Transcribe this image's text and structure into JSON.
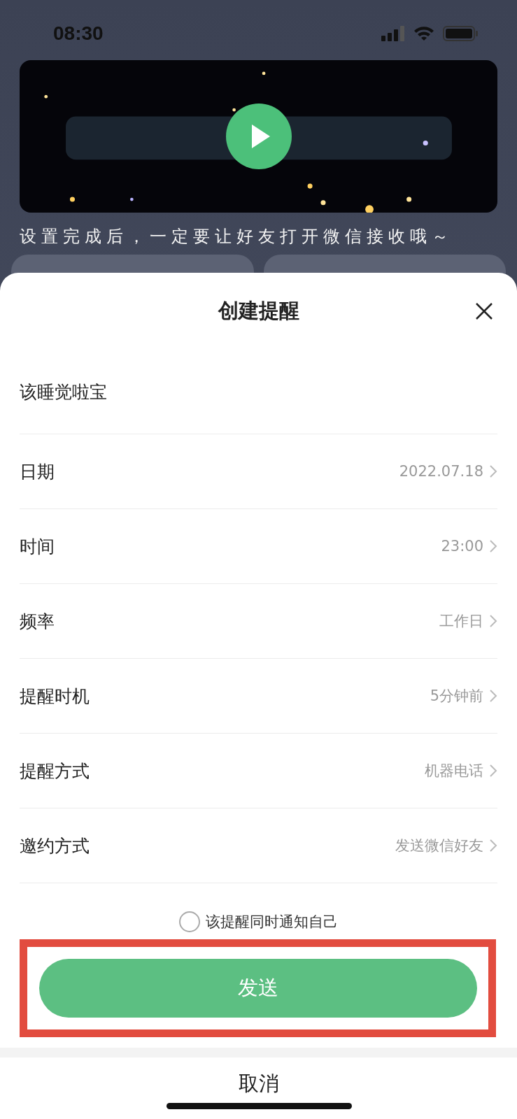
{
  "status_bar": {
    "time": "08:30"
  },
  "banner": {
    "kind": "picture",
    "caption": "设置完成后，一定要让好友打开微信接收哦～"
  },
  "sheet": {
    "title": "创建提醒",
    "name_field": {
      "value": "该睡觉啦宝"
    },
    "rows": [
      {
        "label": "日期",
        "value": "2022.07.18"
      },
      {
        "label": "时间",
        "value": "23:00"
      },
      {
        "label": "频率",
        "value": "工作日"
      },
      {
        "label": "提醒时机",
        "value": "5分钟前"
      },
      {
        "label": "提醒方式",
        "value": "机器电话"
      },
      {
        "label": "邀约方式",
        "value": "发送微信好友"
      }
    ],
    "notify_self": {
      "label": "该提醒同时通知自己",
      "checked": false
    },
    "send_button": {
      "label": "发送",
      "highlighted": true
    },
    "cancel_button": {
      "label": "取消"
    }
  }
}
